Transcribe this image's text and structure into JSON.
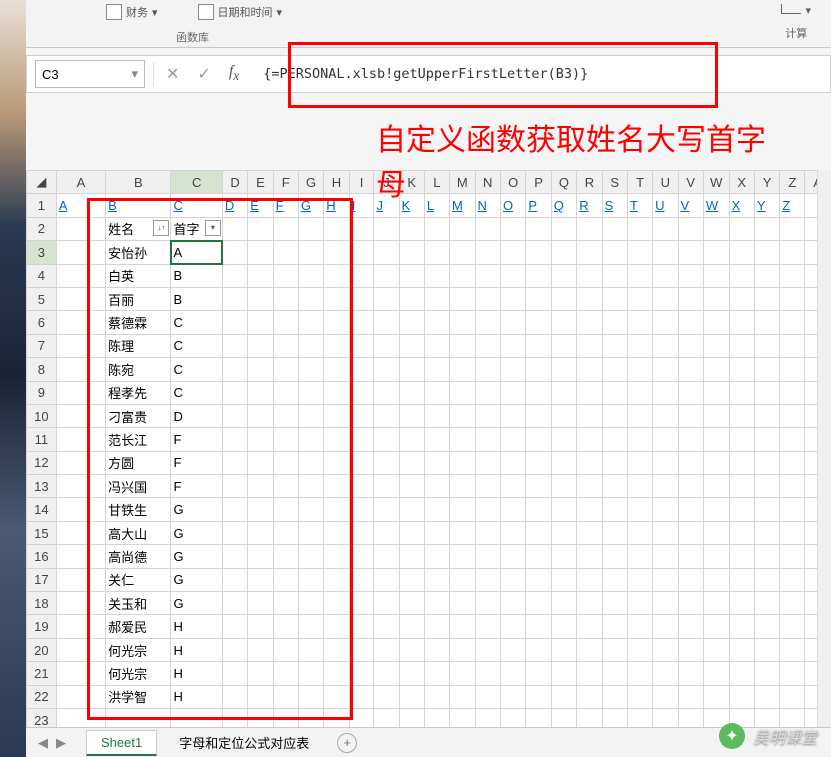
{
  "ribbon": {
    "partial1_label": "财务",
    "partial2_label": "日期和时间",
    "group_label": "函数库",
    "calc_label": "计算"
  },
  "name_box": "C3",
  "formula": "{=PERSONAL.xlsb!getUpperFirstLetter(B3)}",
  "annotation_line1": "自定义函数获取姓名大写首字",
  "annotation_line2": "母",
  "col_headers": [
    "A",
    "B",
    "C",
    "D",
    "E",
    "F",
    "G",
    "H",
    "I",
    "J",
    "K",
    "L",
    "M",
    "N",
    "O",
    "P",
    "Q",
    "R",
    "S",
    "T",
    "U",
    "V",
    "W",
    "X",
    "Y",
    "Z",
    "A"
  ],
  "link_row": [
    "A",
    "B",
    "C",
    "D",
    "E",
    "F",
    "G",
    "H",
    "I",
    "J",
    "K",
    "L",
    "M",
    "N",
    "O",
    "P",
    "Q",
    "R",
    "S",
    "T",
    "U",
    "V",
    "W",
    "X",
    "Y",
    "Z"
  ],
  "table_headers": {
    "name": "姓名",
    "letter": "首字"
  },
  "rows": [
    {
      "r": 3,
      "name": "安怡孙",
      "letter": "A"
    },
    {
      "r": 4,
      "name": "白英",
      "letter": "B"
    },
    {
      "r": 5,
      "name": "百丽",
      "letter": "B"
    },
    {
      "r": 6,
      "name": "蔡德霖",
      "letter": "C"
    },
    {
      "r": 7,
      "name": "陈理",
      "letter": "C"
    },
    {
      "r": 8,
      "name": "陈宛",
      "letter": "C"
    },
    {
      "r": 9,
      "name": "程孝先",
      "letter": "C"
    },
    {
      "r": 10,
      "name": "刁富贵",
      "letter": "D"
    },
    {
      "r": 11,
      "name": "范长江",
      "letter": "F"
    },
    {
      "r": 12,
      "name": "方圆",
      "letter": "F"
    },
    {
      "r": 13,
      "name": "冯兴国",
      "letter": "F"
    },
    {
      "r": 14,
      "name": "甘铁生",
      "letter": "G"
    },
    {
      "r": 15,
      "name": "高大山",
      "letter": "G"
    },
    {
      "r": 16,
      "name": "高尚德",
      "letter": "G"
    },
    {
      "r": 17,
      "name": "关仁",
      "letter": "G"
    },
    {
      "r": 18,
      "name": "关玉和",
      "letter": "G"
    },
    {
      "r": 19,
      "name": "郝爱民",
      "letter": "H"
    },
    {
      "r": 20,
      "name": "何光宗",
      "letter": "H"
    },
    {
      "r": 21,
      "name": "何光宗",
      "letter": "H"
    },
    {
      "r": 22,
      "name": "洪学智",
      "letter": "H"
    }
  ],
  "row23": 23,
  "tabs": {
    "active": "Sheet1",
    "other": "字母和定位公式对应表"
  },
  "watermark": "吴明课堂"
}
